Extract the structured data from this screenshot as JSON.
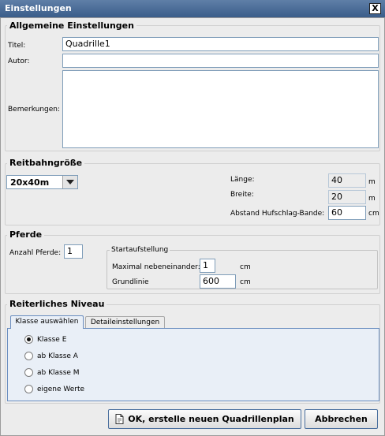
{
  "window": {
    "title": "Einstellungen",
    "close_glyph": "X"
  },
  "general": {
    "heading": "Allgemeine Einstellungen",
    "title_label": "Titel:",
    "title_value": "Quadrille1",
    "author_label": "Autor:",
    "author_value": "",
    "remarks_label": "Bemerkungen:",
    "remarks_value": ""
  },
  "arena": {
    "heading": "Reitbahngröße",
    "size_selected": "20x40m",
    "length_label": "Länge:",
    "length_value": "40",
    "length_unit": "m",
    "width_label": "Breite:",
    "width_value": "20",
    "width_unit": "m",
    "distance_label": "Abstand Hufschlag-Bande:",
    "distance_value": "60",
    "distance_unit": "cm"
  },
  "horses": {
    "heading": "Pferde",
    "count_label": "Anzahl Pferde:",
    "count_value": "1",
    "start_heading": "Startaufstellung",
    "max_label": "Maximal nebeneinander:",
    "max_value": "1",
    "max_unit": "cm",
    "baseline_label": "Grundlinie",
    "baseline_value": "600",
    "baseline_unit": "cm"
  },
  "level": {
    "heading": "Reiterliches Niveau",
    "tabs": [
      "Klasse auswählen",
      "Detaileinstellungen"
    ],
    "options": [
      "Klasse E",
      "ab Klasse A",
      "ab Klasse M",
      "eigene Werte"
    ],
    "selected_index": 0
  },
  "buttons": {
    "ok_label": "OK, erstelle neuen Quadrillenplan",
    "cancel_label": "Abbrechen"
  },
  "icons": {
    "close": "close-icon",
    "ok": "document-icon",
    "dropdown": "chevron-down-icon"
  }
}
